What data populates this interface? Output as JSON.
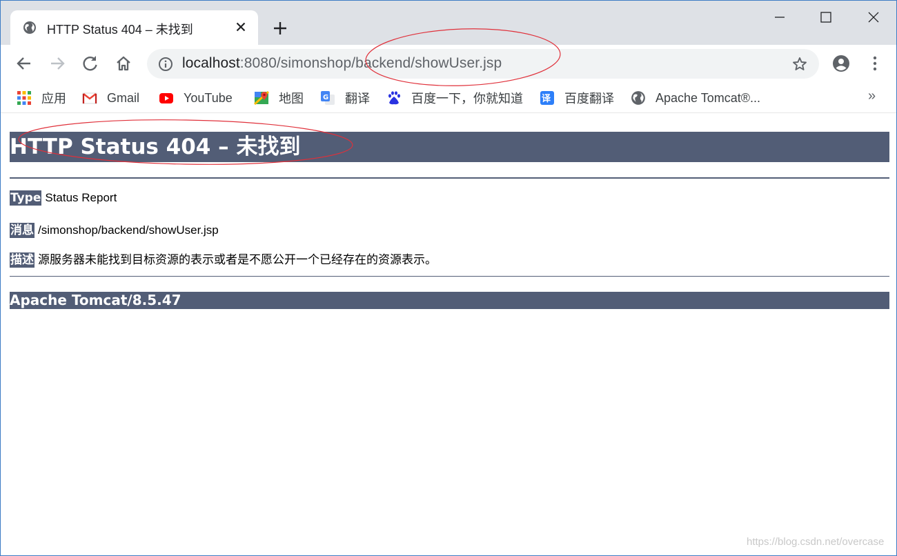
{
  "browser": {
    "tab": {
      "title": "HTTP Status 404 – 未找到",
      "close_label": "×"
    },
    "new_tab_label": "+",
    "address": {
      "host": "localhost",
      "rest": ":8080/simonshop/backend/showUser.jsp"
    },
    "bookmarks": [
      {
        "label": "应用",
        "icon": "apps-grid-icon"
      },
      {
        "label": "Gmail",
        "icon": "gmail-icon"
      },
      {
        "label": "YouTube",
        "icon": "youtube-icon"
      },
      {
        "label": "地图",
        "icon": "maps-icon"
      },
      {
        "label": "翻译",
        "icon": "translate-icon"
      },
      {
        "label": "百度一下，你就知道",
        "icon": "baidu-icon"
      },
      {
        "label": "百度翻译",
        "icon": "baidu-translate-icon"
      },
      {
        "label": "Apache Tomcat®...",
        "icon": "globe-icon"
      }
    ],
    "bookmarks_more": "»"
  },
  "page": {
    "heading": "HTTP Status 404 – 未找到",
    "type_label": "Type",
    "type_value": "Status Report",
    "message_label": "消息",
    "message_value": "/simonshop/backend/showUser.jsp",
    "description_label": "描述",
    "description_value": "源服务器未能找到目标资源的表示或者是不愿公开一个已经存在的资源表示。",
    "footer": "Apache Tomcat/8.5.47"
  },
  "watermark": "https://blog.csdn.net/overcase",
  "colors": {
    "tomcat_bar": "#525d76",
    "tab_strip": "#dee1e6",
    "annotation_red": "#e0303a"
  }
}
